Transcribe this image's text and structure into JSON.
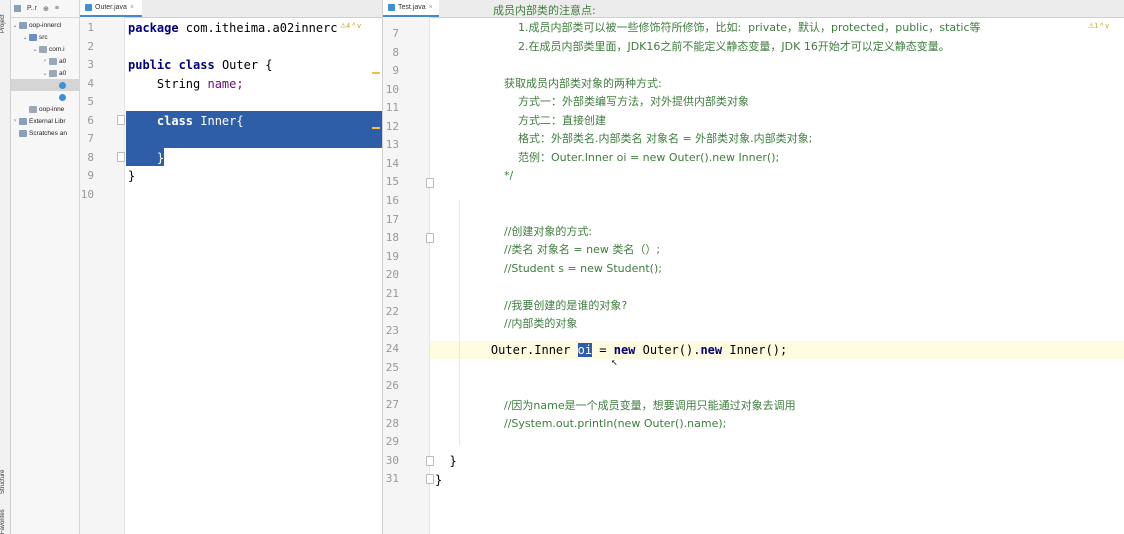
{
  "toolstrip": {
    "project_label": "Project",
    "structure_label": "Structure",
    "favorites_label": "Favorites"
  },
  "project": {
    "header_label": "P..r",
    "items": [
      {
        "label": "oop-innercl",
        "depth": 0,
        "arrow": "v",
        "icon": "folder"
      },
      {
        "label": "src",
        "depth": 1,
        "arrow": "v",
        "icon": "folder-src"
      },
      {
        "label": "com.i",
        "depth": 2,
        "arrow": "v",
        "icon": "pkg"
      },
      {
        "label": "a0",
        "depth": 3,
        "arrow": ">",
        "icon": "pkg"
      },
      {
        "label": "a0",
        "depth": 3,
        "arrow": "v",
        "icon": "pkg"
      },
      {
        "label": "",
        "depth": 4,
        "arrow": "",
        "icon": "cls"
      },
      {
        "label": "",
        "depth": 4,
        "arrow": "",
        "icon": "cls"
      },
      {
        "label": "oop-inne",
        "depth": 1,
        "arrow": "",
        "icon": "pkg"
      },
      {
        "label": "External Libr",
        "depth": 0,
        "arrow": ">",
        "icon": "folder"
      },
      {
        "label": "Scratches an",
        "depth": 0,
        "arrow": "",
        "icon": "folder"
      }
    ]
  },
  "left_editor": {
    "tab": "Outer.java",
    "warning": "4",
    "line_numbers": [
      "1",
      "2",
      "3",
      "4",
      "5",
      "6",
      "7",
      "8",
      "9",
      "10"
    ],
    "lines": {
      "l1_kw": "package",
      "l1_rest": " com.itheima.a02innerc",
      "l3_kw1": "public",
      "l3_kw2": " class",
      "l3_rest": " Outer {",
      "l4_type": "    String",
      "l4_name": " name;",
      "l6_kw": "    class",
      "l6_rest": " Inner{",
      "l8_text": "    }",
      "l9_text": "}"
    }
  },
  "right_editor": {
    "tab": "Test.java",
    "warning": "1",
    "line_numbers": [
      "7",
      "8",
      "9",
      "10",
      "11",
      "12",
      "13",
      "14",
      "15",
      "16",
      "17",
      "18",
      "19",
      "20",
      "21",
      "22",
      "23",
      "24",
      "25",
      "26",
      "27",
      "28",
      "29",
      "30",
      "31"
    ],
    "top_partial": "成员内部类的注意点:",
    "lines": {
      "l7": "        1.成员内部类可以被一些修饰符所修饰，比如:  private，默认，protected，public，static等",
      "l8": "        2.在成员内部类里面，JDK16之前不能定义静态变量，JDK 16开始才可以定义静态变量。",
      "l10": "    获取成员内部类对象的两种方式:",
      "l11": "        方式一：外部类编写方法，对外提供内部类对象",
      "l12": "        方式二：直接创建",
      "l13": "        格式：外部类名.内部类名 对象名 = 外部类对象.内部类对象;",
      "l14": "        范例：Outer.Inner oi = new Outer().new Inner();",
      "l15": "    */",
      "l18": "    //创建对象的方式:",
      "l19": "    //类名 对象名 = new 类名（）;",
      "l20": "    //Student s = new Student();",
      "l22": "    //我要创建的是谁的对象?",
      "l23": "    //内部类的对象",
      "l24_a": "    Outer.Inner ",
      "l24_sel": "oi",
      "l24_b": " = ",
      "l24_new1": "new",
      "l24_c": " Outer().",
      "l24_new2": "new",
      "l24_d": " Inner();",
      "l27": "    //因为name是一个成员变量，想要调用只能通过对象去调用",
      "l28": "    //System.out.println(new Outer().name);",
      "l30": "  }",
      "l31": "}"
    }
  }
}
